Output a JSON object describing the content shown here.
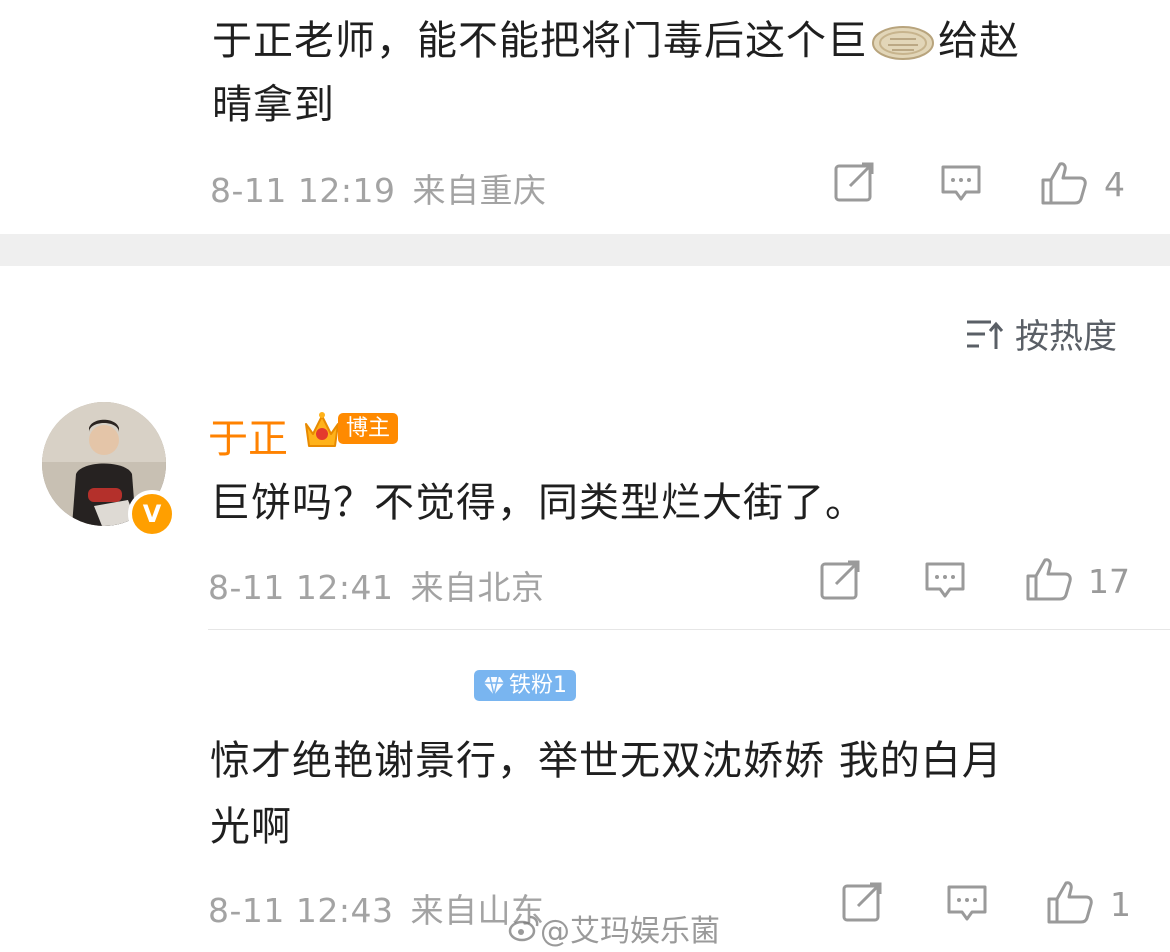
{
  "comments": [
    {
      "text_line1": "于正老师，能不能把将门毒后这个巨",
      "text_after_emoji": "给赵",
      "text_line2": "晴拿到",
      "timestamp": "8-11 12:19",
      "location": "来自重庆",
      "likes": "4"
    },
    {
      "author": "于正",
      "author_badge": "博主",
      "text": "巨饼吗？不觉得，同类型烂大街了。",
      "timestamp": "8-11 12:41",
      "location": "来自北京",
      "likes": "17"
    },
    {
      "fan_badge": "铁粉1",
      "text_line1": "惊才绝艳谢景行，举世无双沈娇娇 我的白月",
      "text_line2": "光啊",
      "timestamp": "8-11 12:43",
      "location": "来自山东",
      "likes": "1"
    }
  ],
  "sort": {
    "label": "按热度",
    "icon": "sort-icon"
  },
  "watermark": "@艾玛娱乐菌",
  "colors": {
    "name_orange": "#ff8200",
    "meta_gray": "#a3a3a3",
    "fan_badge_blue": "#79b5f0",
    "bozhu_badge_orange": "#ff8a00"
  },
  "icons": {
    "repost": "repost-icon",
    "comment": "comment-icon",
    "like": "like-icon",
    "emoji": "pie-emoji-icon",
    "verified": "verified-v-icon",
    "crown": "crown-icon",
    "diamond": "diamond-icon"
  }
}
